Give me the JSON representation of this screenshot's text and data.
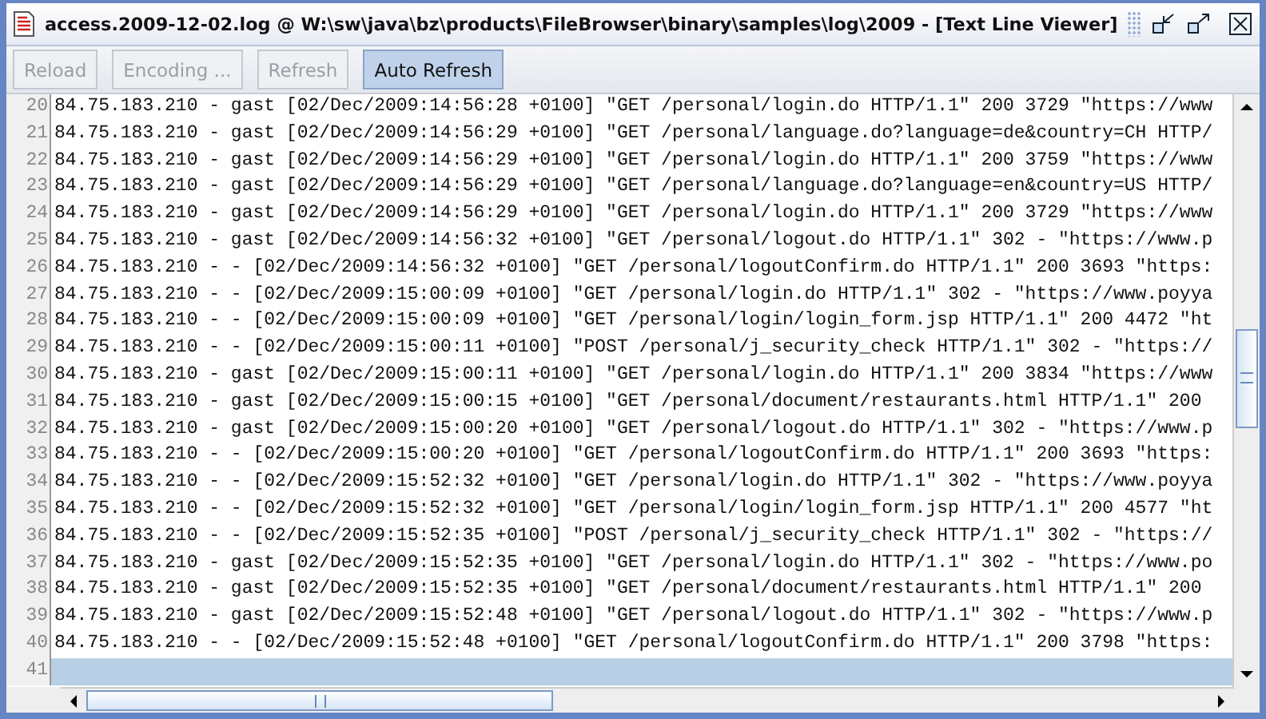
{
  "window": {
    "title": "access.2009-12-02.log @ W:\\sw\\java\\bz\\products\\FileBrowser\\binary\\samples\\log\\2009 - [Text Line Viewer]"
  },
  "toolbar": [
    {
      "label": "Reload",
      "disabled": true,
      "selected": false
    },
    {
      "label": "Encoding ...",
      "disabled": true,
      "selected": false
    },
    {
      "label": "Refresh",
      "disabled": true,
      "selected": false
    },
    {
      "label": "Auto Refresh",
      "disabled": false,
      "selected": true
    }
  ],
  "lines": [
    {
      "number": "20",
      "text": "84.75.183.210 - gast [02/Dec/2009:14:56:28 +0100] \"GET /personal/login.do HTTP/1.1\" 200 3729 \"https://www",
      "selected": false
    },
    {
      "number": "21",
      "text": "84.75.183.210 - gast [02/Dec/2009:14:56:29 +0100] \"GET /personal/language.do?language=de&country=CH HTTP/",
      "selected": false
    },
    {
      "number": "22",
      "text": "84.75.183.210 - gast [02/Dec/2009:14:56:29 +0100] \"GET /personal/login.do HTTP/1.1\" 200 3759 \"https://www",
      "selected": false
    },
    {
      "number": "23",
      "text": "84.75.183.210 - gast [02/Dec/2009:14:56:29 +0100] \"GET /personal/language.do?language=en&country=US HTTP/",
      "selected": false
    },
    {
      "number": "24",
      "text": "84.75.183.210 - gast [02/Dec/2009:14:56:29 +0100] \"GET /personal/login.do HTTP/1.1\" 200 3729 \"https://www",
      "selected": false
    },
    {
      "number": "25",
      "text": "84.75.183.210 - gast [02/Dec/2009:14:56:32 +0100] \"GET /personal/logout.do HTTP/1.1\" 302 - \"https://www.p",
      "selected": false
    },
    {
      "number": "26",
      "text": "84.75.183.210 - - [02/Dec/2009:14:56:32 +0100] \"GET /personal/logoutConfirm.do HTTP/1.1\" 200 3693 \"https:",
      "selected": false
    },
    {
      "number": "27",
      "text": "84.75.183.210 - - [02/Dec/2009:15:00:09 +0100] \"GET /personal/login.do HTTP/1.1\" 302 - \"https://www.poyya",
      "selected": false
    },
    {
      "number": "28",
      "text": "84.75.183.210 - - [02/Dec/2009:15:00:09 +0100] \"GET /personal/login/login_form.jsp HTTP/1.1\" 200 4472 \"ht",
      "selected": false
    },
    {
      "number": "29",
      "text": "84.75.183.210 - - [02/Dec/2009:15:00:11 +0100] \"POST /personal/j_security_check HTTP/1.1\" 302 - \"https://",
      "selected": false
    },
    {
      "number": "30",
      "text": "84.75.183.210 - gast [02/Dec/2009:15:00:11 +0100] \"GET /personal/login.do HTTP/1.1\" 200 3834 \"https://www",
      "selected": false
    },
    {
      "number": "31",
      "text": "84.75.183.210 - gast [02/Dec/2009:15:00:15 +0100] \"GET /personal/document/restaurants.html HTTP/1.1\" 200",
      "selected": false
    },
    {
      "number": "32",
      "text": "84.75.183.210 - gast [02/Dec/2009:15:00:20 +0100] \"GET /personal/logout.do HTTP/1.1\" 302 - \"https://www.p",
      "selected": false
    },
    {
      "number": "33",
      "text": "84.75.183.210 - - [02/Dec/2009:15:00:20 +0100] \"GET /personal/logoutConfirm.do HTTP/1.1\" 200 3693 \"https:",
      "selected": false
    },
    {
      "number": "34",
      "text": "84.75.183.210 - - [02/Dec/2009:15:52:32 +0100] \"GET /personal/login.do HTTP/1.1\" 302 - \"https://www.poyya",
      "selected": false
    },
    {
      "number": "35",
      "text": "84.75.183.210 - - [02/Dec/2009:15:52:32 +0100] \"GET /personal/login/login_form.jsp HTTP/1.1\" 200 4577 \"ht",
      "selected": false
    },
    {
      "number": "36",
      "text": "84.75.183.210 - - [02/Dec/2009:15:52:35 +0100] \"POST /personal/j_security_check HTTP/1.1\" 302 - \"https://",
      "selected": false
    },
    {
      "number": "37",
      "text": "84.75.183.210 - gast [02/Dec/2009:15:52:35 +0100] \"GET /personal/login.do HTTP/1.1\" 302 - \"https://www.po",
      "selected": false
    },
    {
      "number": "38",
      "text": "84.75.183.210 - gast [02/Dec/2009:15:52:35 +0100] \"GET /personal/document/restaurants.html HTTP/1.1\" 200",
      "selected": false
    },
    {
      "number": "39",
      "text": "84.75.183.210 - gast [02/Dec/2009:15:52:48 +0100] \"GET /personal/logout.do HTTP/1.1\" 302 - \"https://www.p",
      "selected": false
    },
    {
      "number": "40",
      "text": "84.75.183.210 - - [02/Dec/2009:15:52:48 +0100] \"GET /personal/logoutConfirm.do HTTP/1.1\" 200 3798 \"https:",
      "selected": false
    },
    {
      "number": "41",
      "selected": true
    }
  ]
}
